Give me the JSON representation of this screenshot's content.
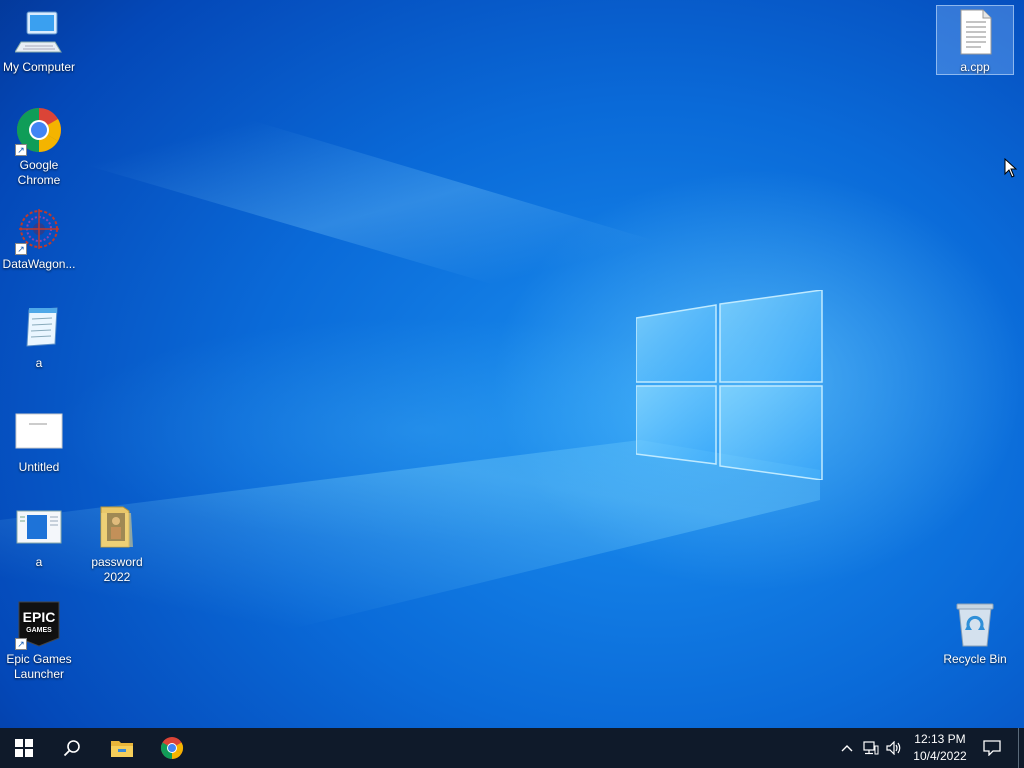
{
  "desktop": {
    "icons": [
      {
        "label": "My Computer",
        "icon": "computer-icon",
        "shortcut": false
      },
      {
        "label": "Google Chrome",
        "icon": "chrome-icon",
        "shortcut": true
      },
      {
        "label": "DataWagon...",
        "icon": "datawagon-icon",
        "shortcut": true
      },
      {
        "label": "a",
        "icon": "notepad-icon",
        "shortcut": false
      },
      {
        "label": "Untitled",
        "icon": "image-file-icon",
        "shortcut": false
      },
      {
        "label": "a",
        "icon": "window-file-icon",
        "shortcut": false
      },
      {
        "label": "password 2022",
        "icon": "folder-icon",
        "shortcut": false
      },
      {
        "label": "Epic Games Launcher",
        "icon": "epic-games-icon",
        "shortcut": true
      },
      {
        "label": "a.cpp",
        "icon": "text-file-icon",
        "shortcut": false,
        "selected": true
      },
      {
        "label": "Recycle Bin",
        "icon": "recycle-bin-icon",
        "shortcut": false
      }
    ],
    "epic_logo_text": [
      "EPIC",
      "GAMES"
    ]
  },
  "taskbar": {
    "start": "windows-start-icon",
    "search": "search-icon",
    "pinned": [
      {
        "name": "File Explorer",
        "icon": "file-explorer-icon"
      },
      {
        "name": "Google Chrome",
        "icon": "chrome-icon"
      }
    ],
    "tray": {
      "time": "12:13 PM",
      "date": "10/4/2022",
      "icons": [
        "chevron-up-icon",
        "network-icon",
        "volume-icon",
        "notification-icon"
      ]
    }
  },
  "colors": {
    "taskbar": "#0f1a2a",
    "accent": "#76b9ed",
    "desktop": "#0a6ad8"
  }
}
